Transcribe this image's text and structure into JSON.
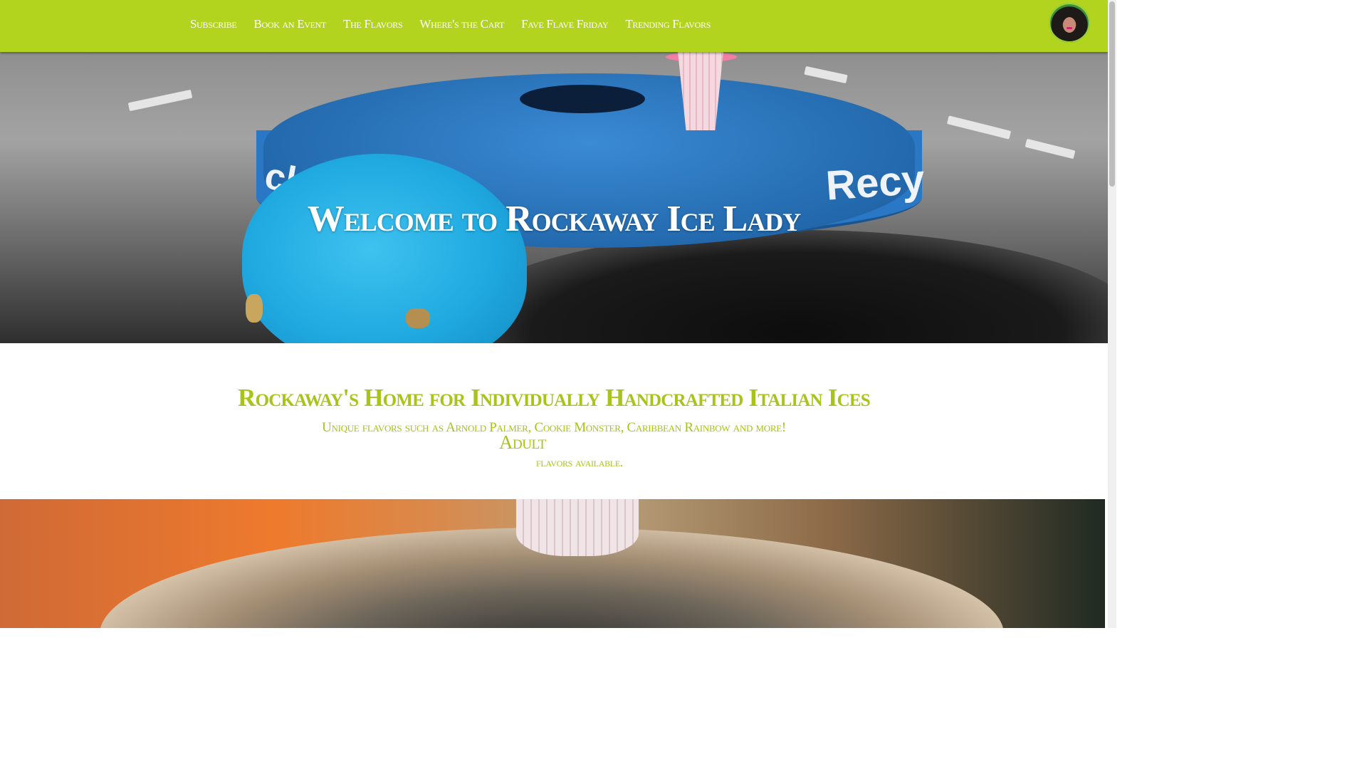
{
  "nav": {
    "links": [
      {
        "label": "Subscribe"
      },
      {
        "label": "Book an Event"
      },
      {
        "label": "The Flavors"
      },
      {
        "label": "Where's the Cart"
      },
      {
        "label": "Fave Flave Friday"
      },
      {
        "label": "Trending Flavors"
      }
    ],
    "logo_icon": "avatar-logo-icon"
  },
  "hero": {
    "title": "Welcome to Rockaway Ice Lady"
  },
  "intro": {
    "tagline": "Rockaway's Home for Individually Handcrafted Italian Ices",
    "unique": "Unique flavors such as Arnold Palmer, Cookie Monster, Caribbean Rainbow and more!",
    "adult": "Adult",
    "available": "flavors available."
  },
  "colors": {
    "nav_bg": "#b3d41f",
    "accent_text": "#a6c41a",
    "nav_text": "#ffffff"
  }
}
